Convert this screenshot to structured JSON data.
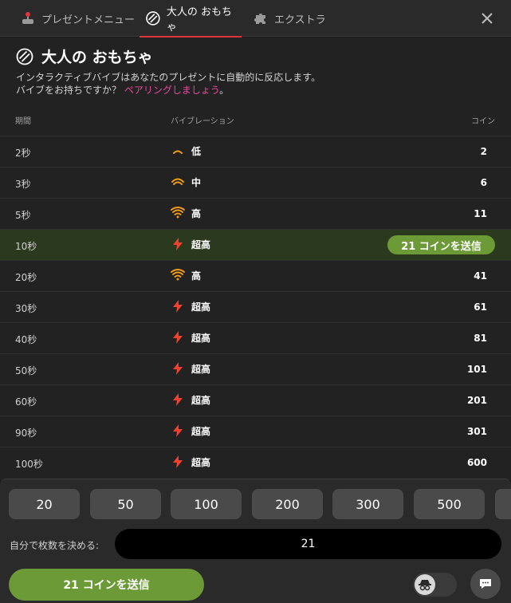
{
  "tabs": [
    {
      "label": "プレゼントメニュー",
      "icon": "joystick-icon",
      "active": false
    },
    {
      "label": "大人の おもちゃ",
      "icon": "vibe-toy-icon",
      "active": true
    },
    {
      "label": "エクストラ",
      "icon": "puzzle-icon",
      "active": false
    }
  ],
  "header": {
    "title": "大人の おもちゃ",
    "desc_line1": "インタラクティブバイブはあなたのプレゼントに自動的に反応します。",
    "desc_line2": "バイブをお持ちですか？",
    "pair_link": "ペアリングしましょう",
    "desc_end": "。"
  },
  "table": {
    "headers": {
      "duration": "期間",
      "vibration": "バイブレーション",
      "coins": "コイン"
    },
    "rows": [
      {
        "duration": "2秒",
        "level": "低",
        "icon": "wave-low-icon",
        "coins": "2"
      },
      {
        "duration": "3秒",
        "level": "中",
        "icon": "wave-mid-icon",
        "coins": "6"
      },
      {
        "duration": "5秒",
        "level": "高",
        "icon": "wave-high-icon",
        "coins": "11"
      },
      {
        "duration": "10秒",
        "level": "超高",
        "icon": "lightning-icon",
        "coins": "",
        "active": true,
        "send_label": "21 コインを送信"
      },
      {
        "duration": "20秒",
        "level": "高",
        "icon": "wave-high-icon",
        "coins": "41"
      },
      {
        "duration": "30秒",
        "level": "超高",
        "icon": "lightning-icon",
        "coins": "61"
      },
      {
        "duration": "40秒",
        "level": "超高",
        "icon": "lightning-icon",
        "coins": "81"
      },
      {
        "duration": "50秒",
        "level": "超高",
        "icon": "lightning-icon",
        "coins": "101"
      },
      {
        "duration": "60秒",
        "level": "超高",
        "icon": "lightning-icon",
        "coins": "201"
      },
      {
        "duration": "90秒",
        "level": "超高",
        "icon": "lightning-icon",
        "coins": "301"
      },
      {
        "duration": "100秒",
        "level": "超高",
        "icon": "lightning-icon",
        "coins": "600"
      }
    ]
  },
  "bottom": {
    "amounts": [
      "20",
      "50",
      "100",
      "200",
      "300",
      "500",
      ""
    ],
    "custom_label": "自分で枚数を決める:",
    "custom_value": "21",
    "send_label": "21 コインを送信",
    "anon_icon": "spy-icon",
    "chat_icon": "chat-icon"
  },
  "colors": {
    "accent_green": "#6b9a37",
    "tab_underline": "#e0333a",
    "link_pink": "#e84aa0",
    "wave_orange": "#f39c12",
    "lightning_red": "#f0402e"
  }
}
